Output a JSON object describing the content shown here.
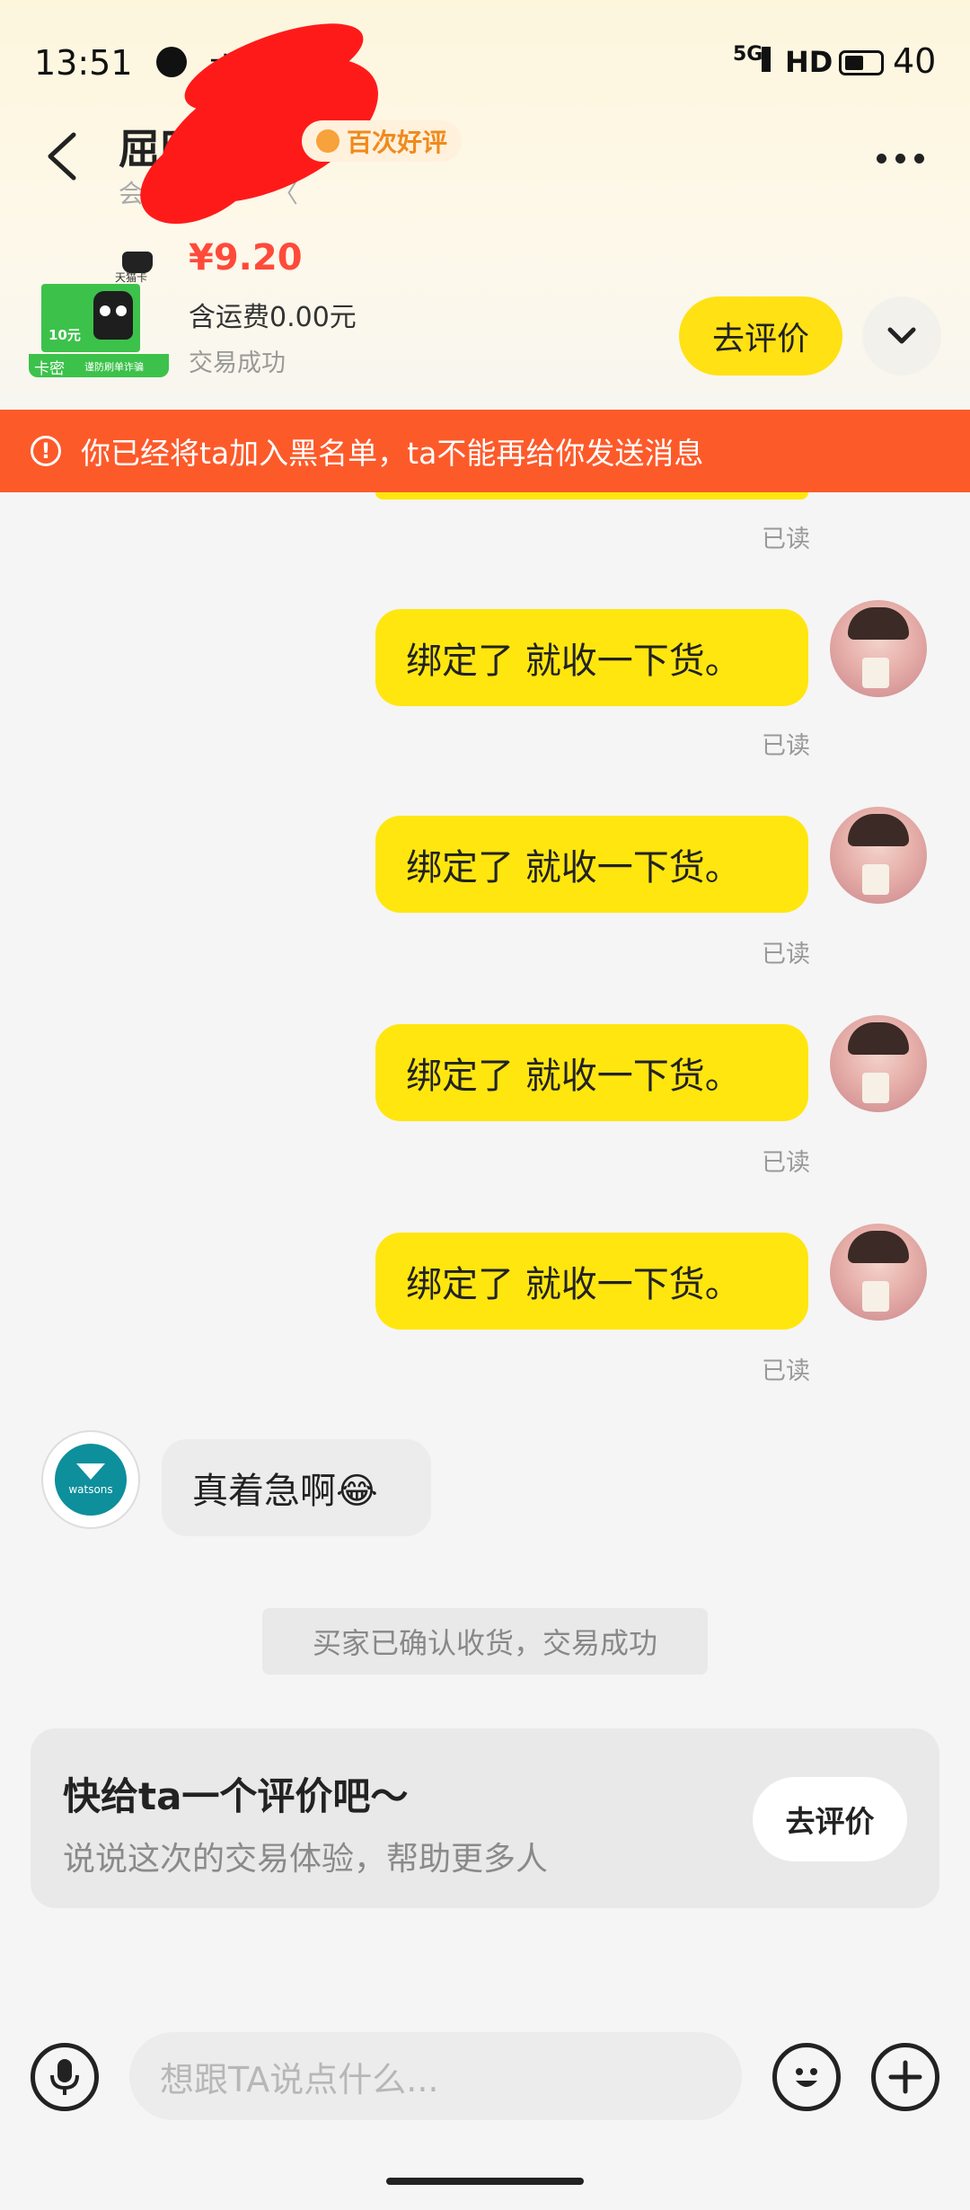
{
  "status_bar": {
    "time": "13:51",
    "app_icon_text": "支",
    "signal": "5G",
    "hd": "HD",
    "battery": "40"
  },
  "header": {
    "name": "屈田",
    "subtitle": "会",
    "subtitle_tail": "〈",
    "badge": "百次好评",
    "back_icon": "chevron-left-icon",
    "more_icon": "more-dots-icon"
  },
  "product": {
    "card_brand": "天猫卡",
    "card_value": "10元",
    "card_label": "卡密",
    "card_note": "谨防刷单诈骗",
    "price": "¥9.20",
    "shipping": "含运费0.00元",
    "status": "交易成功",
    "eval_button": "去评价",
    "expand_icon": "chevron-down-icon"
  },
  "warning": {
    "icon": "alert-circle-icon",
    "text": "你已经将ta加入黑名单，ta不能再给你发送消息"
  },
  "messages": [
    {
      "text": "绑定了  就收一下货。",
      "read": "已读"
    },
    {
      "text": "绑定了  就收一下货。",
      "read": "已读"
    },
    {
      "text": "绑定了  就收一下货。",
      "read": "已读"
    },
    {
      "text": "绑定了  就收一下货。",
      "read": "已读"
    }
  ],
  "first_read": "已读",
  "other_message": {
    "text": "真着急啊😂",
    "avatar_text": "watsons"
  },
  "system_notice": "买家已确认收货，交易成功",
  "review_card": {
    "title": "快给ta一个评价吧～",
    "subtitle": "说说这次的交易体验，帮助更多人",
    "button": "去评价"
  },
  "composer": {
    "placeholder": "想跟TA说点什么...",
    "mic_icon": "microphone-icon",
    "emoji_icon": "emoji-icon",
    "plus_icon": "plus-icon"
  },
  "colors": {
    "accent_yellow": "#ffe114",
    "warning_orange": "#fd5a2a",
    "price_red": "#ff4a3a"
  }
}
